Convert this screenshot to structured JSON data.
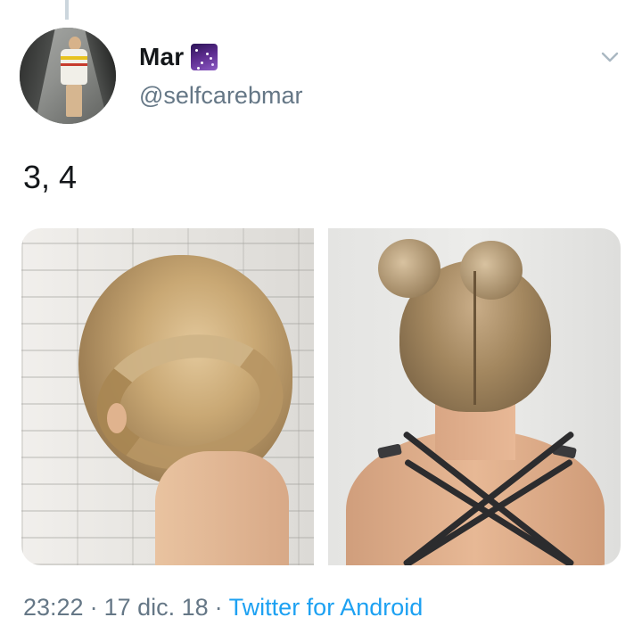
{
  "tweet": {
    "author": {
      "display_name": "Mar",
      "name_emoji": "milky-way-emoji",
      "handle": "@selfcarebmar"
    },
    "text": "3, 4",
    "media": [
      {
        "icon": "photo-braided-crown-updo"
      },
      {
        "icon": "photo-double-dutch-braid-space-buns"
      }
    ],
    "meta": {
      "time": "23:22",
      "date": "17 dic. 18",
      "separator": "·",
      "client": "Twitter for Android"
    }
  },
  "colors": {
    "text_primary": "#14171a",
    "text_secondary": "#657786",
    "link": "#1da1f2",
    "thread_line": "#ccd6dd"
  }
}
